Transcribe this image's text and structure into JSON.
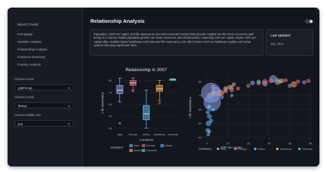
{
  "sidebar": {
    "title": "SELECT PAGE",
    "nav": [
      "Homepage",
      "Variable Analysis",
      "Relationship Analysis",
      "Continent Summary",
      "Country Analysis"
    ],
    "x_axis": {
      "label": "Choose x-axis",
      "value": "gdpPercap"
    },
    "y_axis": {
      "label": "Choose y-axis",
      "value": "lifeExp"
    },
    "bubble": {
      "label": "Choose bubble size",
      "value": "pop"
    }
  },
  "main": {
    "title": "Relationship Analysis",
    "description": "Population, GDP per capita, and life expectancy are interconnected metrics that provide insights into the socio-economic well-being of a country. Rapid population growth can strain resources and infrastructure, impacting GDP per capita. Higher GDP per capita often enables better healthcare and improved life expectancy, but other factors such as healthcare quality and social policies also play significant roles.",
    "updated": {
      "title": "Last updated",
      "date": "July, 2023"
    }
  },
  "colors": {
    "Asia": "#8aa0e6",
    "Europe": "#e07080",
    "Africa": "#5eb6f0",
    "Americas": "#f0a658",
    "Oceania": "#3ec9a0"
  },
  "chart_data": [
    {
      "type": "box",
      "title": "Relationship in 2007",
      "xlabel": "Continent",
      "ylabel": "Life expectancy",
      "categories": [
        "Asia",
        "Europe",
        "Africa",
        "Americas",
        "Oceania"
      ],
      "yticks": [
        40,
        50,
        60,
        70,
        80
      ],
      "ylim": [
        38,
        85
      ],
      "boxes": [
        {
          "name": "Asia",
          "min": 62,
          "q1": 69,
          "median": 72,
          "q3": 76,
          "max": 82
        },
        {
          "name": "Europe",
          "min": 72,
          "q1": 76,
          "median": 78,
          "q3": 80,
          "max": 82
        },
        {
          "name": "Africa",
          "min": 40,
          "q1": 47,
          "median": 52,
          "q3": 59,
          "max": 72
        },
        {
          "name": "Americas",
          "min": 63,
          "q1": 71,
          "median": 73,
          "q3": 76,
          "max": 80
        },
        {
          "name": "Oceania",
          "min": 80.2,
          "q1": 80.5,
          "median": 81,
          "q3": 81.2,
          "max": 81.4
        }
      ],
      "outliers": [
        {
          "name": "Asia",
          "y": 44
        },
        {
          "name": "Asia",
          "y": 44
        },
        {
          "name": "Europe",
          "y": 71
        },
        {
          "name": "Americas",
          "y": 61
        }
      ],
      "legend_title": "Continent",
      "legend": [
        "Asia",
        "Europe",
        "Africa",
        "Americas",
        "Oceania"
      ]
    },
    {
      "type": "scatter",
      "xlabel": "GDP per capita",
      "ylabel": "Life expectancy",
      "xticks": [
        0,
        10,
        20,
        30,
        40,
        50
      ],
      "xtick_labels": [
        "0",
        "10",
        "20",
        "30",
        "40",
        "50"
      ],
      "xlim": [
        -2,
        52
      ],
      "ylim": [
        38,
        85
      ],
      "legend_title": "Continent",
      "legend": [
        "Asia",
        "Europe",
        "Africa",
        "Americas",
        "Oceania"
      ],
      "points": [
        {
          "name": "Asia",
          "x": 2,
          "y": 72,
          "s": 14
        },
        {
          "name": "Asia",
          "x": 2.5,
          "y": 65,
          "s": 12
        },
        {
          "name": "Asia",
          "x": 4.5,
          "y": 73,
          "s": 6
        },
        {
          "name": "Asia",
          "x": 1.5,
          "y": 70,
          "s": 4
        },
        {
          "name": "Asia",
          "x": 5.5,
          "y": 71.5,
          "s": 3.5
        },
        {
          "name": "Asia",
          "x": 7,
          "y": 69,
          "s": 3
        },
        {
          "name": "Asia",
          "x": 3,
          "y": 76,
          "s": 3
        },
        {
          "name": "Asia",
          "x": 9,
          "y": 74,
          "s": 2.5
        },
        {
          "name": "Asia",
          "x": 12,
          "y": 76,
          "s": 2.5
        },
        {
          "name": "Asia",
          "x": 22,
          "y": 79,
          "s": 3
        },
        {
          "name": "Asia",
          "x": 28,
          "y": 78.5,
          "s": 3.5
        },
        {
          "name": "Asia",
          "x": 32,
          "y": 82,
          "s": 5
        },
        {
          "name": "Asia",
          "x": 35,
          "y": 80,
          "s": 3
        },
        {
          "name": "Asia",
          "x": 40,
          "y": 77,
          "s": 2.5
        },
        {
          "name": "Asia",
          "x": 47,
          "y": 79.5,
          "s": 2.5
        },
        {
          "name": "Asia",
          "x": 1,
          "y": 62,
          "s": 2.5
        },
        {
          "name": "Asia",
          "x": 1.2,
          "y": 44,
          "s": 2
        },
        {
          "name": "Europe",
          "x": 6,
          "y": 72,
          "s": 2.5
        },
        {
          "name": "Europe",
          "x": 9,
          "y": 73,
          "s": 2.5
        },
        {
          "name": "Europe",
          "x": 12,
          "y": 74,
          "s": 3
        },
        {
          "name": "Europe",
          "x": 15,
          "y": 75,
          "s": 2.5
        },
        {
          "name": "Europe",
          "x": 20,
          "y": 77,
          "s": 2.5
        },
        {
          "name": "Europe",
          "x": 25,
          "y": 79,
          "s": 3
        },
        {
          "name": "Europe",
          "x": 28,
          "y": 80,
          "s": 3.5
        },
        {
          "name": "Europe",
          "x": 31,
          "y": 80.5,
          "s": 3
        },
        {
          "name": "Europe",
          "x": 34,
          "y": 79.5,
          "s": 3.5
        },
        {
          "name": "Europe",
          "x": 38,
          "y": 81,
          "s": 2.5
        },
        {
          "name": "Europe",
          "x": 44,
          "y": 80,
          "s": 2.5
        },
        {
          "name": "Europe",
          "x": 49,
          "y": 80.5,
          "s": 2.5
        },
        {
          "name": "Africa",
          "x": 0.5,
          "y": 45,
          "s": 3
        },
        {
          "name": "Africa",
          "x": 0.8,
          "y": 50,
          "s": 3.5
        },
        {
          "name": "Africa",
          "x": 1.2,
          "y": 55,
          "s": 3
        },
        {
          "name": "Africa",
          "x": 0.4,
          "y": 58,
          "s": 2.5
        },
        {
          "name": "Africa",
          "x": 2,
          "y": 52,
          "s": 2.5
        },
        {
          "name": "Africa",
          "x": 1,
          "y": 62,
          "s": 2.5
        },
        {
          "name": "Africa",
          "x": 3,
          "y": 60,
          "s": 2
        },
        {
          "name": "Africa",
          "x": 0.6,
          "y": 42,
          "s": 2
        },
        {
          "name": "Africa",
          "x": 4,
          "y": 72,
          "s": 2
        },
        {
          "name": "Africa",
          "x": 12,
          "y": 70,
          "s": 2
        },
        {
          "name": "Americas",
          "x": 3,
          "y": 72,
          "s": 3
        },
        {
          "name": "Americas",
          "x": 7,
          "y": 72,
          "s": 3.5
        },
        {
          "name": "Americas",
          "x": 9,
          "y": 75,
          "s": 3
        },
        {
          "name": "Americas",
          "x": 11,
          "y": 76,
          "s": 3
        },
        {
          "name": "Americas",
          "x": 13,
          "y": 78,
          "s": 2.5
        },
        {
          "name": "Americas",
          "x": 36,
          "y": 80.5,
          "s": 3
        },
        {
          "name": "Americas",
          "x": 42,
          "y": 78,
          "s": 4
        },
        {
          "name": "Oceania",
          "x": 25,
          "y": 80,
          "s": 2.5
        },
        {
          "name": "Oceania",
          "x": 34,
          "y": 81,
          "s": 3
        }
      ]
    }
  ]
}
